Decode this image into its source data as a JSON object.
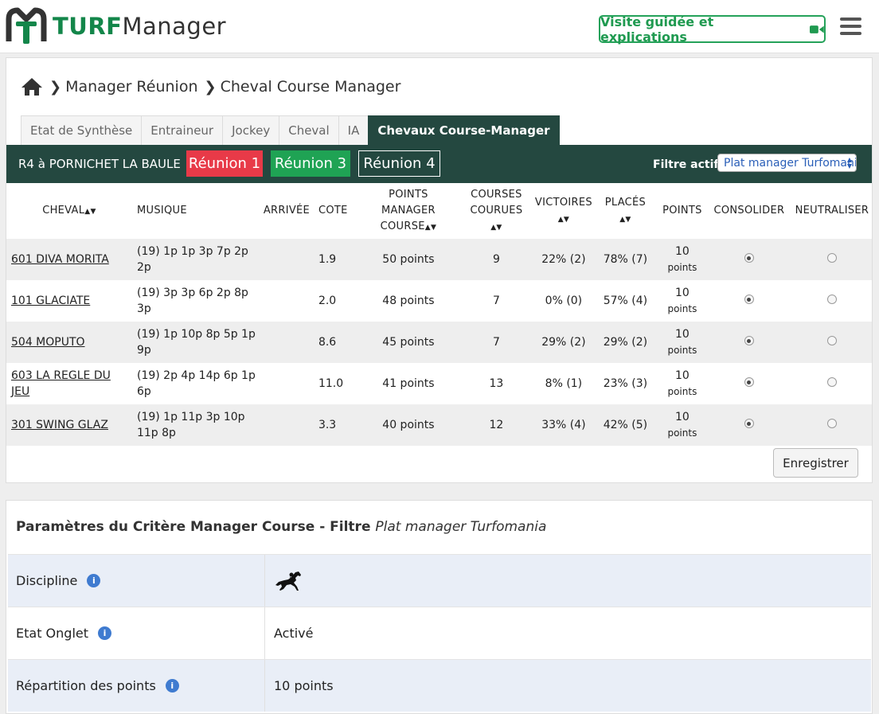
{
  "header": {
    "logo_turf": "TURF",
    "logo_manager": "Manager",
    "guide_label": "Visite guidée et explications",
    "brand_colors": {
      "green": "#13864a",
      "dark": "#244840",
      "red": "#e83a48",
      "bright_green": "#1fa354"
    }
  },
  "breadcrumb": {
    "items": [
      "Manager Réunion",
      "Cheval Course Manager"
    ]
  },
  "tabs": [
    "Etat de Synthèse",
    "Entraineur",
    "Jockey",
    "Cheval",
    "IA",
    "Chevaux Course-Manager"
  ],
  "active_tab": "Chevaux Course-Manager",
  "race": {
    "name": "R4 à PORNICHET LA BAULE",
    "reunions": [
      "Réunion 1",
      "Réunion 3",
      "Réunion 4"
    ],
    "filter_label": "Filtre actif :",
    "filter_value": "Plat manager Turfomania"
  },
  "table": {
    "headers": {
      "cheval": "CHEVAL",
      "musique": "MUSIQUE",
      "arrivee": "ARRIVÉE",
      "cote": "COTE",
      "points_mc_1": "POINTS",
      "points_mc_2": "MANAGER",
      "points_mc_3": "COURSE",
      "courses_1": "COURSES",
      "courses_2": "COURUES",
      "victoires": "VICTOIRES",
      "places": "PLACÉS",
      "points": "POINTS",
      "consolider": "CONSOLIDER",
      "neutraliser": "NEUTRALISER"
    },
    "rows": [
      {
        "cheval": "601 DIVA MORITA",
        "musique": "(19) 1p 1p 3p 7p 2p 2p",
        "arrivee": "",
        "cote": "1.9",
        "points_mc": "50 points",
        "courses": "9",
        "victoires": "22% (2)",
        "places": "78% (7)",
        "points_num": "10",
        "points_unit": "points",
        "consolider": true,
        "neutraliser": false
      },
      {
        "cheval": "101 GLACIATE",
        "musique": "(19) 3p 3p 6p 2p 8p 3p",
        "arrivee": "",
        "cote": "2.0",
        "points_mc": "48 points",
        "courses": "7",
        "victoires": "0% (0)",
        "places": "57% (4)",
        "points_num": "10",
        "points_unit": "points",
        "consolider": true,
        "neutraliser": false
      },
      {
        "cheval": "504 MOPUTO",
        "musique": "(19) 1p 10p 8p 5p 1p 9p",
        "arrivee": "",
        "cote": "8.6",
        "points_mc": "45 points",
        "courses": "7",
        "victoires": "29% (2)",
        "places": "29% (2)",
        "points_num": "10",
        "points_unit": "points",
        "consolider": true,
        "neutraliser": false
      },
      {
        "cheval": "603 LA REGLE DU JEU",
        "musique": "(19) 2p 4p 14p 6p 1p 6p",
        "arrivee": "",
        "cote": "11.0",
        "points_mc": "41 points",
        "courses": "13",
        "victoires": "8% (1)",
        "places": "23% (3)",
        "points_num": "10",
        "points_unit": "points",
        "consolider": true,
        "neutraliser": false
      },
      {
        "cheval": "301 SWING GLAZ",
        "musique": "(19) 1p 11p 3p 10p 11p 8p",
        "arrivee": "",
        "cote": "3.3",
        "points_mc": "40 points",
        "courses": "12",
        "victoires": "33% (4)",
        "places": "42% (5)",
        "points_num": "10",
        "points_unit": "points",
        "consolider": true,
        "neutraliser": false
      }
    ],
    "save_label": "Enregistrer"
  },
  "params": {
    "title_prefix": "Paramètres du Critère Manager Course - Filtre ",
    "title_filter": "Plat manager Turfomania",
    "rows": [
      {
        "label": "Discipline",
        "value": "",
        "icon": "galloping-horse-icon"
      },
      {
        "label": "Etat Onglet",
        "value": "Activé"
      },
      {
        "label": "Répartition des points",
        "value": "10 points"
      }
    ]
  }
}
